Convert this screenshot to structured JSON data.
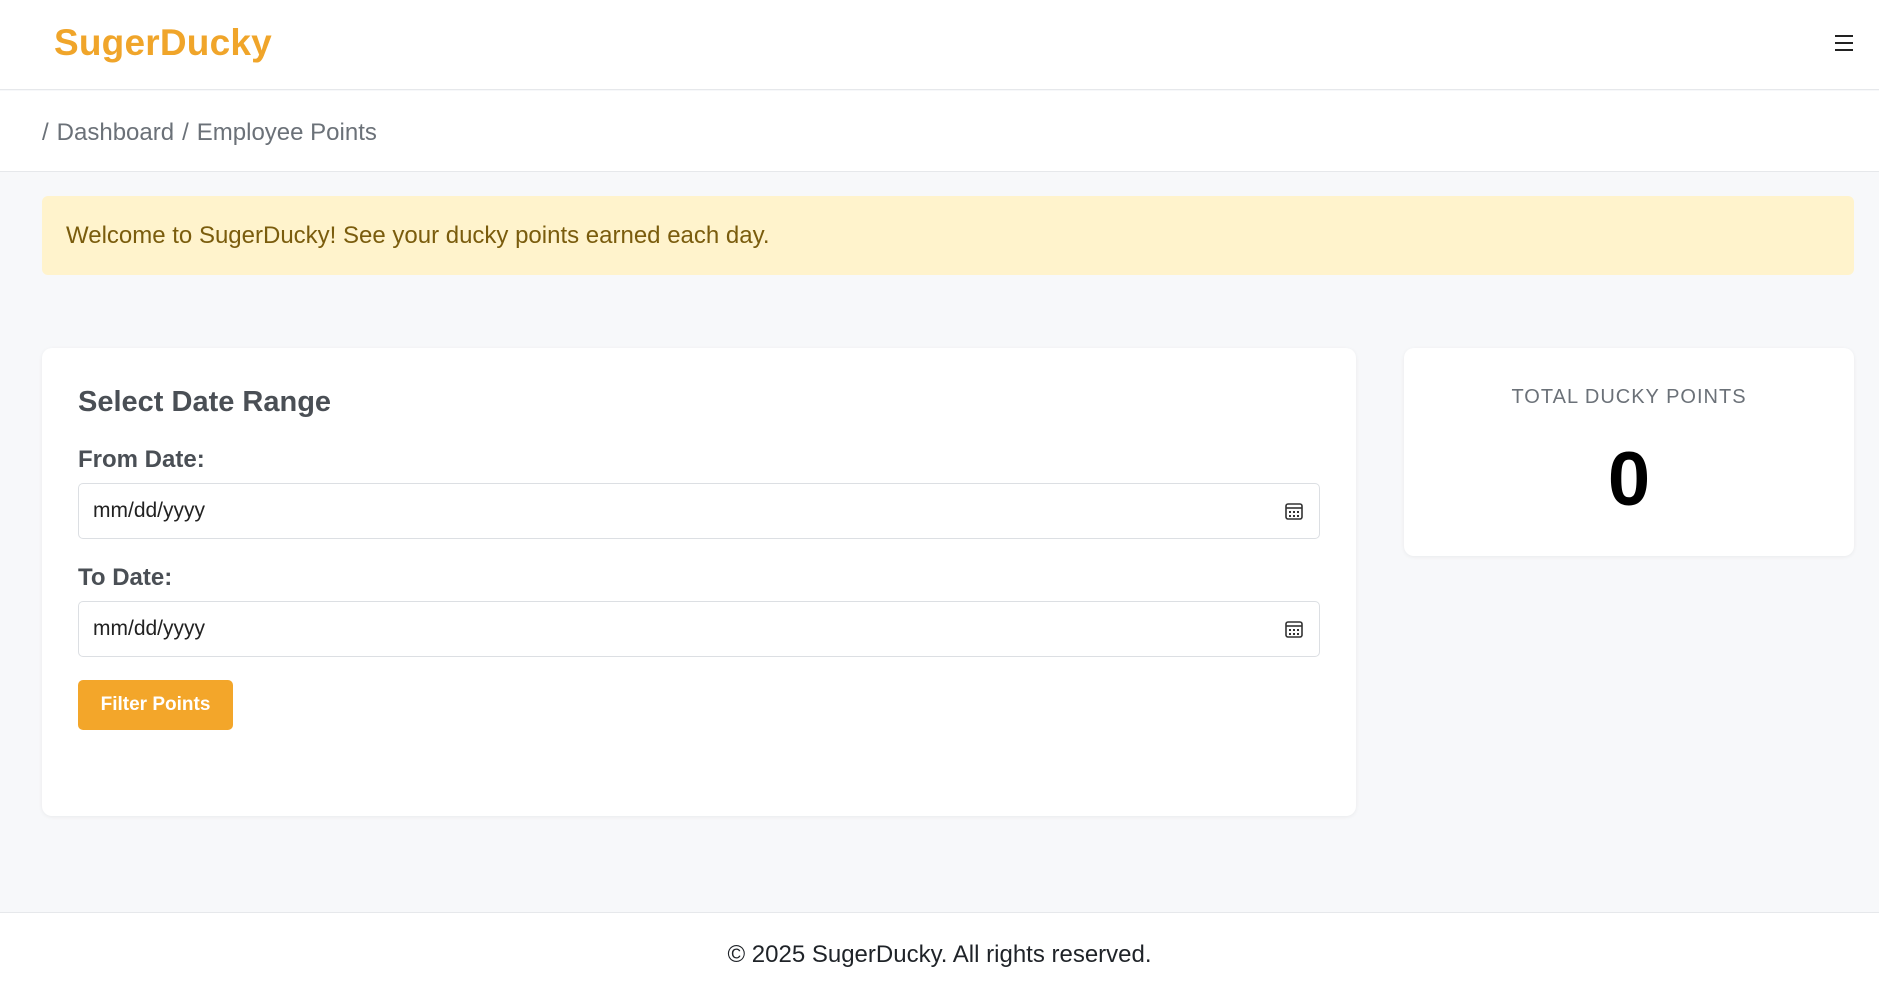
{
  "header": {
    "brand": "SugerDucky",
    "menu_icon": "hamburger-menu-icon",
    "brand_color": "#f0a52a"
  },
  "breadcrumb": {
    "separator": "/",
    "items": [
      "Dashboard",
      "Employee Points"
    ]
  },
  "alert": {
    "message": "Welcome to SugerDucky! See your ducky points earned each day.",
    "background": "#fff3cc"
  },
  "date_form": {
    "title": "Select Date Range",
    "from_label": "From Date:",
    "from_value": "mm/dd/yyyy",
    "to_label": "To Date:",
    "to_value": "mm/dd/yyyy",
    "calendar_icon": "calendar-icon",
    "submit_label": "Filter Points",
    "accent": "#f3a62a"
  },
  "points": {
    "label": "TOTAL DUCKY POINTS",
    "value": "0"
  },
  "footer": {
    "text": "© 2025 SugerDucky. All rights reserved."
  }
}
